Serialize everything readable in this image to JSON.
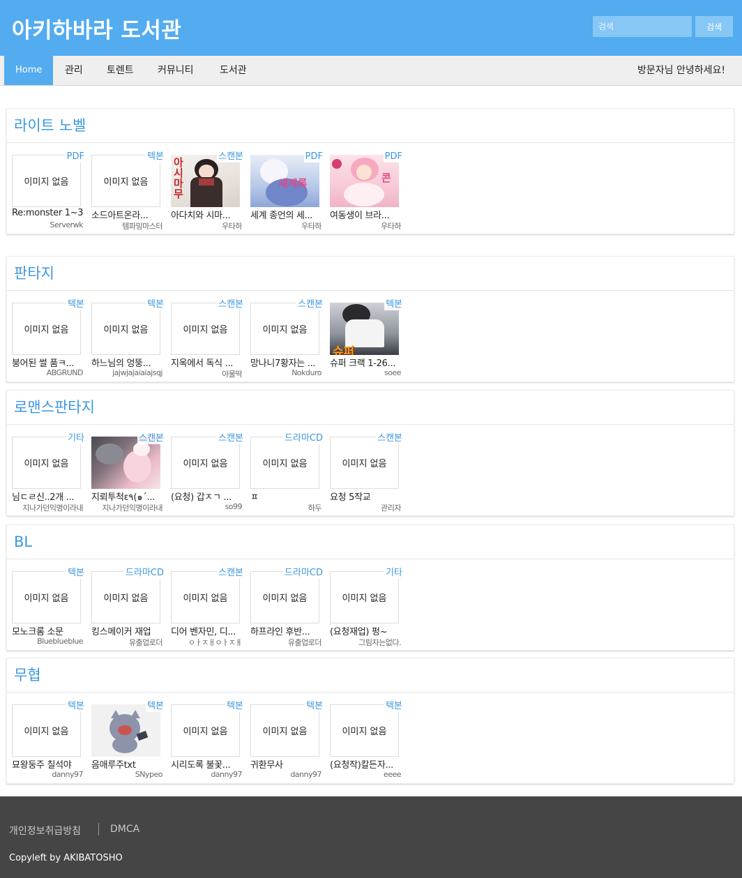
{
  "header": {
    "title": "아키하바라 도서관",
    "search_placeholder": "검색",
    "search_button": "검색"
  },
  "nav": {
    "items": [
      "Home",
      "관리",
      "토렌트",
      "커뮤니티",
      "도서관"
    ],
    "greeting": "방문자님 안녕하세요!"
  },
  "no_image_text": "이미지 없음",
  "sections": [
    {
      "title": "라이트 노벨",
      "items": [
        {
          "badge": "PDF",
          "title": "Re:monster 1~3...",
          "user": "Serverwk",
          "thumb": "none"
        },
        {
          "badge": "텍본",
          "title": "소드아트온라...",
          "user": "템파밍마스터",
          "thumb": "none"
        },
        {
          "badge": "스캔본",
          "title": "아다치와 시마...",
          "user": "우타하",
          "thumb": "cover-girl-dark"
        },
        {
          "badge": "PDF",
          "title": "세계 종언의 세...",
          "user": "우타하",
          "thumb": "cover-girl-blue"
        },
        {
          "badge": "PDF",
          "title": "여동생이 브라...",
          "user": "우타하",
          "thumb": "cover-girl-pink"
        }
      ]
    },
    {
      "title": "판타지",
      "items": [
        {
          "badge": "텍본",
          "title": "붕어된 썰 품ㅋ...",
          "user": "ABGRUND",
          "thumb": "none"
        },
        {
          "badge": "텍본",
          "title": "하느님의 엉뚱...",
          "user": "jajwjajaiaiajsqj",
          "thumb": "none"
        },
        {
          "badge": "스캔본",
          "title": "지옥에서 독식 ...",
          "user": "야물딱",
          "thumb": "none"
        },
        {
          "badge": "스캔본",
          "title": "망나니7황자는 ...",
          "user": "Nokduro",
          "thumb": "none"
        },
        {
          "badge": "텍본",
          "title": "슈퍼 크랙 1-26...",
          "user": "soee",
          "thumb": "cover-soccer"
        }
      ]
    },
    {
      "title": "로맨스판타지",
      "items": [
        {
          "badge": "기타",
          "title": "님ㄷㄹ신..2개 ...",
          "user": "지나가던익명이라내",
          "thumb": "none"
        },
        {
          "badge": "스캔본",
          "title": "지뢰투척ε٩(๑ˊ...",
          "user": "지나가던익명이라내",
          "thumb": "cover-wolf"
        },
        {
          "badge": "스캔본",
          "title": "(요청) 갑ㅈㄱ ...",
          "user": "so99",
          "thumb": "none"
        },
        {
          "badge": "드라마CD",
          "title": "ㅍ",
          "user": "하두",
          "thumb": "none"
        },
        {
          "badge": "스캔본",
          "title": "요청 5작교",
          "user": "관리자",
          "thumb": "none"
        }
      ]
    },
    {
      "title": "BL",
      "items": [
        {
          "badge": "텍본",
          "title": "모노크롬 소문",
          "user": "Bluebluebluе",
          "thumb": "none"
        },
        {
          "badge": "드라마CD",
          "title": "킹스메이커 재업",
          "user": "유출업로더",
          "thumb": "none"
        },
        {
          "badge": "스캔본",
          "title": "디어 벤자민, 디...",
          "user": "ㅇㅏㅈㅐㅇㅏㅈㅐ",
          "thumb": "none"
        },
        {
          "badge": "드라마CD",
          "title": "하프라인 후반...",
          "user": "유출업로더",
          "thumb": "none"
        },
        {
          "badge": "기타",
          "title": "(요청재업) 펑~",
          "user": "그림자는없다.",
          "thumb": "none"
        }
      ]
    },
    {
      "title": "무협",
      "items": [
        {
          "badge": "텍본",
          "title": "묘왕둥주 칠석야",
          "user": "danny97",
          "thumb": "none"
        },
        {
          "badge": "텍본",
          "title": "음애루주txt",
          "user": "SNypeo",
          "thumb": "cover-cat"
        },
        {
          "badge": "텍본",
          "title": "시리도록 불꽃...",
          "user": "danny97",
          "thumb": "none"
        },
        {
          "badge": "텍본",
          "title": "귀환무사",
          "user": "danny97",
          "thumb": "none"
        },
        {
          "badge": "텍본",
          "title": "(요청작)칼든자...",
          "user": "eeee",
          "thumb": "none"
        }
      ]
    }
  ],
  "footer": {
    "privacy": "개인정보취급방침",
    "dmca": "DMCA",
    "copyleft": "Copyleft by AKIBATOSHO"
  },
  "colors": {
    "header_bg": "#53abf0",
    "accent_text": "#3b97e0",
    "footer_bg": "#454545"
  }
}
